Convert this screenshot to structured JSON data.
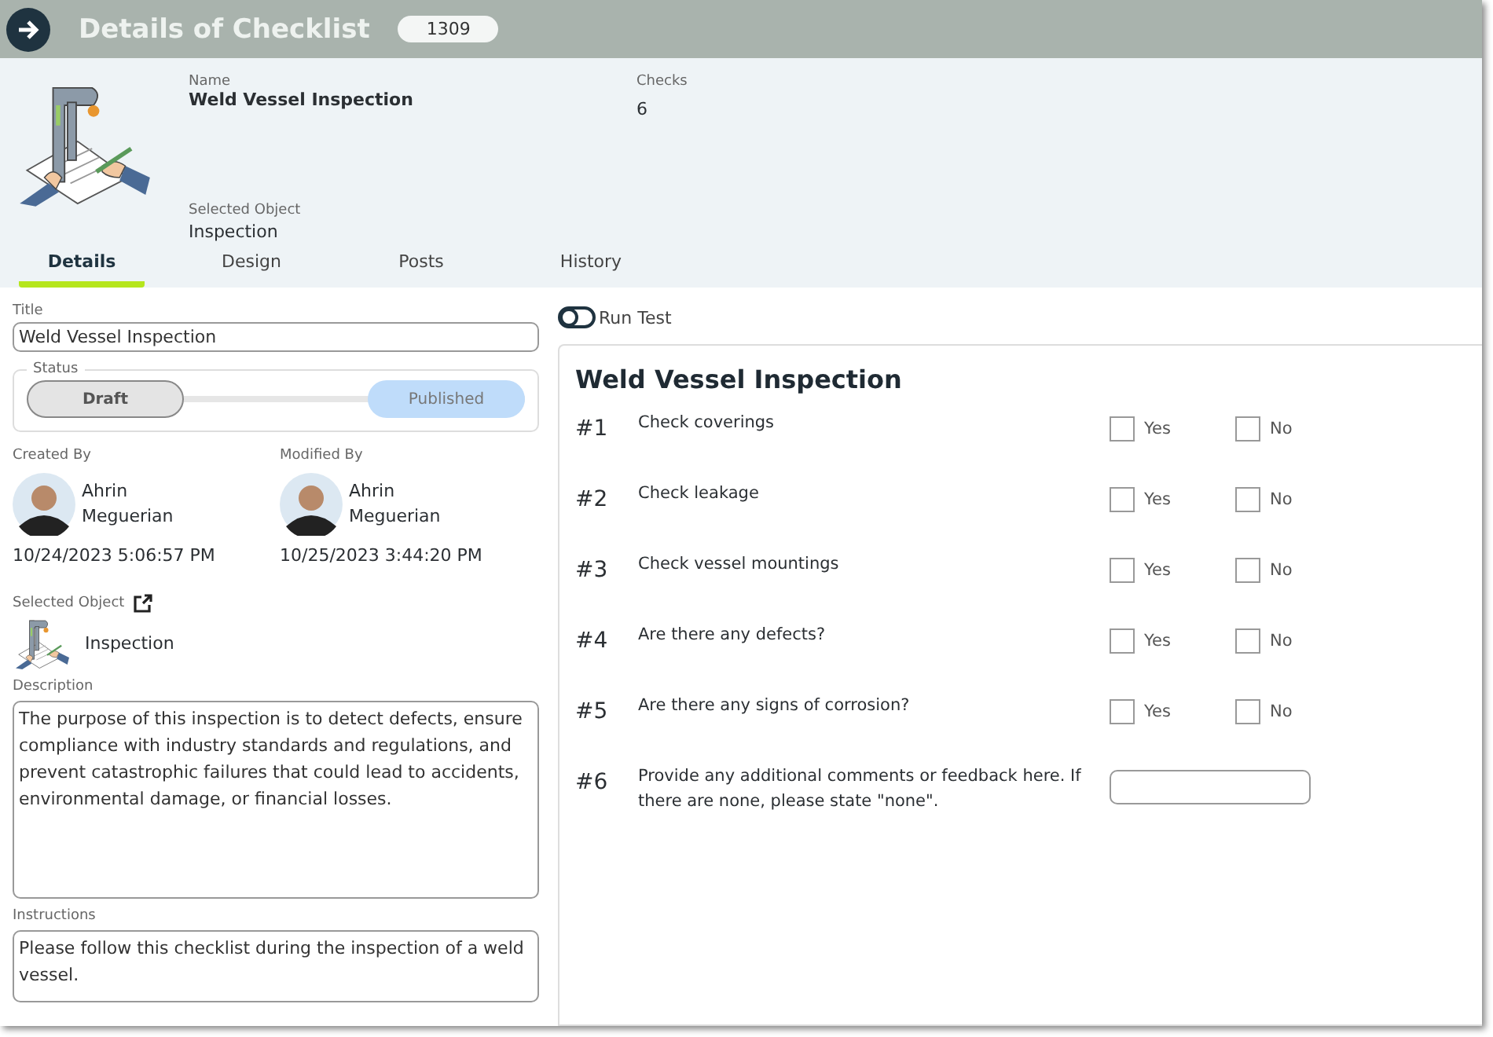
{
  "header": {
    "title": "Details of Checklist",
    "id_badge": "1309"
  },
  "summary": {
    "name_label": "Name",
    "name": "Weld Vessel Inspection",
    "checks_label": "Checks",
    "checks": "6",
    "object_label": "Selected Object",
    "object": "Inspection"
  },
  "tabs": [
    {
      "label": "Details",
      "selected": true
    },
    {
      "label": "Design",
      "selected": false
    },
    {
      "label": "Posts",
      "selected": false
    },
    {
      "label": "History",
      "selected": false
    }
  ],
  "details": {
    "title_label": "Title",
    "title_value": "Weld Vessel Inspection",
    "status_label": "Status",
    "status_options": [
      {
        "label": "Draft",
        "selected": true
      },
      {
        "label": "Published",
        "selected": false
      }
    ],
    "created_label": "Created By",
    "created_name": "Ahrin Meguerian",
    "created_date": "10/24/2023 5:06:57 PM",
    "modified_label": "Modified By",
    "modified_name": "Ahrin Meguerian",
    "modified_date": "10/25/2023 3:44:20 PM",
    "object_label": "Selected Object",
    "object": "Inspection",
    "description_label": "Description",
    "description": "The purpose of this inspection is to detect defects, ensure compliance with industry standards and regulations, and prevent catastrophic failures that could lead to accidents, environmental damage, or financial losses.",
    "instructions_label": "Instructions",
    "instructions": "Please follow this checklist during the inspection of a weld vessel."
  },
  "preview": {
    "run_test": {
      "label": "Run Test",
      "on": false
    },
    "title": "Weld Vessel Inspection",
    "items": [
      {
        "number": "#1",
        "question": "Check coverings",
        "kind": "yesno",
        "options": [
          {
            "label": "Yes",
            "checked": false
          },
          {
            "label": "No",
            "checked": false
          }
        ]
      },
      {
        "number": "#2",
        "question": "Check leakage",
        "kind": "yesno",
        "options": [
          {
            "label": "Yes",
            "checked": false
          },
          {
            "label": "No",
            "checked": false
          }
        ]
      },
      {
        "number": "#3",
        "question": "Check vessel mountings",
        "kind": "yesno",
        "options": [
          {
            "label": "Yes",
            "checked": false
          },
          {
            "label": "No",
            "checked": false
          }
        ]
      },
      {
        "number": "#4",
        "question": "Are there any defects?",
        "kind": "yesno",
        "options": [
          {
            "label": "Yes",
            "checked": false
          },
          {
            "label": "No",
            "checked": false
          }
        ]
      },
      {
        "number": "#5",
        "question": "Are there any signs of corrosion?",
        "kind": "yesno",
        "options": [
          {
            "label": "Yes",
            "checked": false
          },
          {
            "label": "No",
            "checked": false
          }
        ]
      },
      {
        "number": "#6",
        "question": "Provide any additional comments or feedback here. If there are none, please state \"none\".",
        "kind": "text"
      }
    ]
  }
}
